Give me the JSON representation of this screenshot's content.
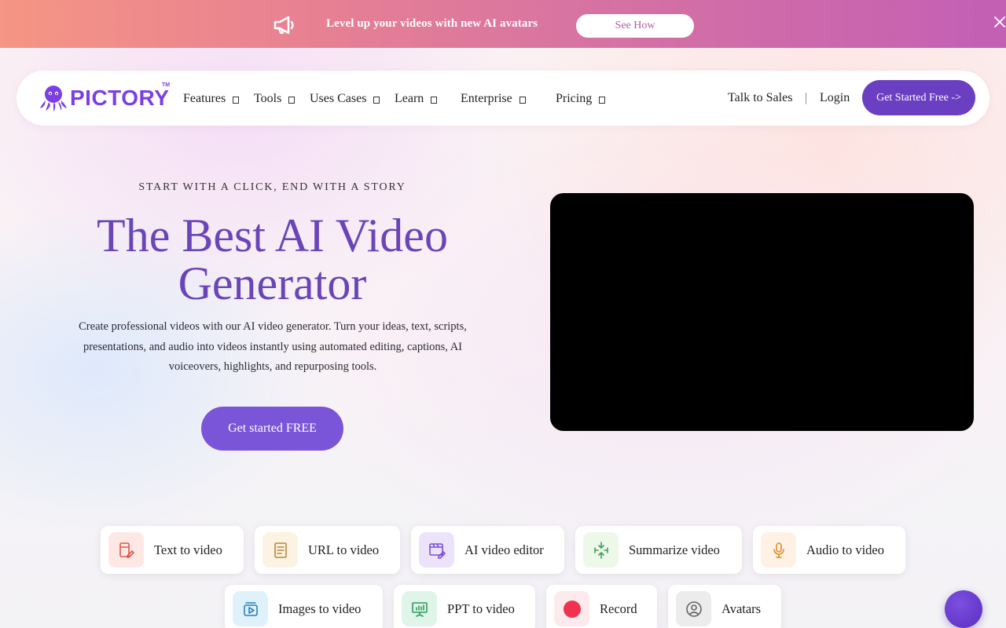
{
  "announcement": {
    "message": "Level up your videos with new AI avatars",
    "button": "See How",
    "icon": "megaphone-icon",
    "close_icon": "close-icon"
  },
  "nav": {
    "brand": "PICTORY",
    "trademark": "TM",
    "items": [
      {
        "label": "Features"
      },
      {
        "label": "Tools"
      },
      {
        "label": "Uses Cases"
      },
      {
        "label": "Learn"
      },
      {
        "label": "Enterprise"
      },
      {
        "label": "Pricing"
      }
    ],
    "talk_to_sales": "Talk to Sales",
    "separator": "|",
    "login": "Login",
    "cta": "Get Started Free ->"
  },
  "hero": {
    "eyebrow": "START WITH A CLICK, END WITH A STORY",
    "title_line1": "The Best AI Video",
    "title_line2": "Generator",
    "description": "Create professional videos with our AI video generator. Turn your ideas, text, scripts, presentations, and audio into videos instantly using automated editing, captions, AI voiceovers, highlights, and repurposing tools.",
    "cta": "Get started FREE"
  },
  "tools": [
    {
      "label": "Text to video",
      "icon": "text-to-video-icon",
      "color": "#e2574c",
      "bg": "#fde8e6"
    },
    {
      "label": "URL to video",
      "icon": "url-document-icon",
      "color": "#b58a3a",
      "bg": "#fdf3e3"
    },
    {
      "label": "AI video editor",
      "icon": "video-editor-icon",
      "color": "#7a4fd8",
      "bg": "#ece3fb"
    },
    {
      "label": "Summarize video",
      "icon": "summarize-icon",
      "color": "#3aa15a",
      "bg": "#eef8e8"
    },
    {
      "label": "Audio to video",
      "icon": "microphone-icon",
      "color": "#e08a2a",
      "bg": "#fff1e3"
    },
    {
      "label": "Images to video",
      "icon": "images-icon",
      "color": "#2a7fb8",
      "bg": "#dff2fb"
    },
    {
      "label": "PPT to video",
      "icon": "presentation-icon",
      "color": "#2e9a5e",
      "bg": "#e0f5e9"
    },
    {
      "label": "Record",
      "icon": "record-icon",
      "color": "#f0314f",
      "bg": "#fdeaed"
    },
    {
      "label": "Avatars",
      "icon": "avatar-icon",
      "color": "#666666",
      "bg": "#ececec"
    }
  ],
  "colors": {
    "brand_purple": "#6a3fc2",
    "hero_title": "#6a45b8",
    "cta_purple": "#7b55d8"
  }
}
